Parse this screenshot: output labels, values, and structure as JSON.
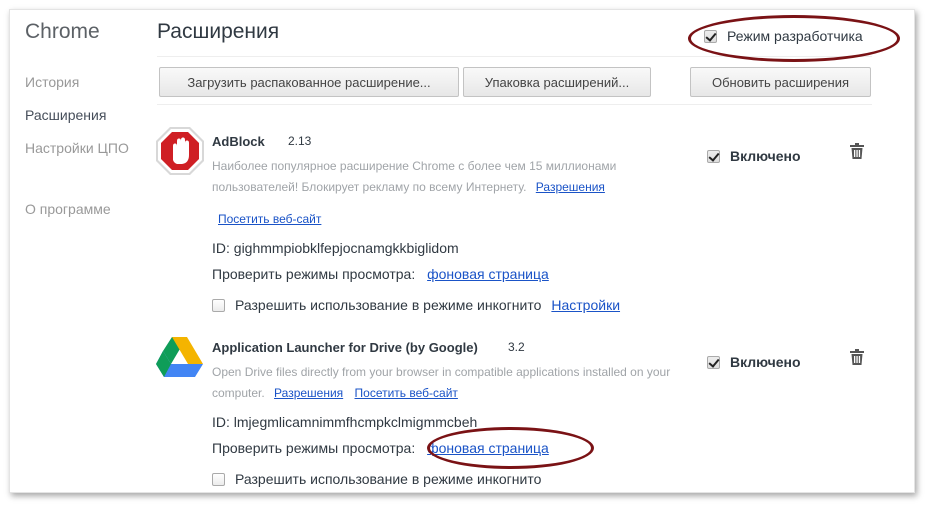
{
  "sidebar": {
    "brand": "Chrome",
    "items": [
      {
        "label": "История"
      },
      {
        "label": "Расширения"
      },
      {
        "label": "Настройки ЦПО"
      },
      {
        "label": "О программе"
      }
    ]
  },
  "header": {
    "title": "Расширения",
    "dev_mode_label": "Режим разработчика",
    "dev_mode_checked": true
  },
  "toolbar": {
    "load_unpacked": "Загрузить распакованное расширение...",
    "pack": "Упаковка расширений...",
    "update": "Обновить расширения"
  },
  "extensions": [
    {
      "name": "AdBlock",
      "version": "2.13",
      "description": "Наиболее популярное расширение Chrome с более чем 15 миллионами пользователей! Блокирует рекламу по всему Интернету.",
      "permissions_link": "Разрешения",
      "website_link": "Посетить веб-сайт",
      "id_text": "ID: gighmmpiobklfepjocnamgkkbiglidom",
      "views_label": "Проверить режимы просмотра:",
      "views_link": "фоновая страница",
      "incognito_label": "Разрешить использование в режиме инкогнито",
      "options_link": "Настройки",
      "enabled_label": "Включено",
      "icon": "adblock-stop-hand-icon"
    },
    {
      "name": "Application Launcher for Drive (by Google)",
      "version": "3.2",
      "description": "Open Drive files directly from your browser in compatible applications installed on your computer.",
      "permissions_link": "Разрешения",
      "website_link": "Посетить веб-сайт",
      "id_text": "ID: lmjegmlicamnimmfhcmpkclmigmmcbeh",
      "views_label": "Проверить режимы просмотра:",
      "views_link": "фоновая страница",
      "incognito_label": "Разрешить использование в режиме инкогнито",
      "enabled_label": "Включено",
      "icon": "google-drive-icon"
    }
  ],
  "colors": {
    "link": "#1a53c7",
    "annotation_oval": "#7a1215",
    "muted_text": "#a0a4a8"
  }
}
